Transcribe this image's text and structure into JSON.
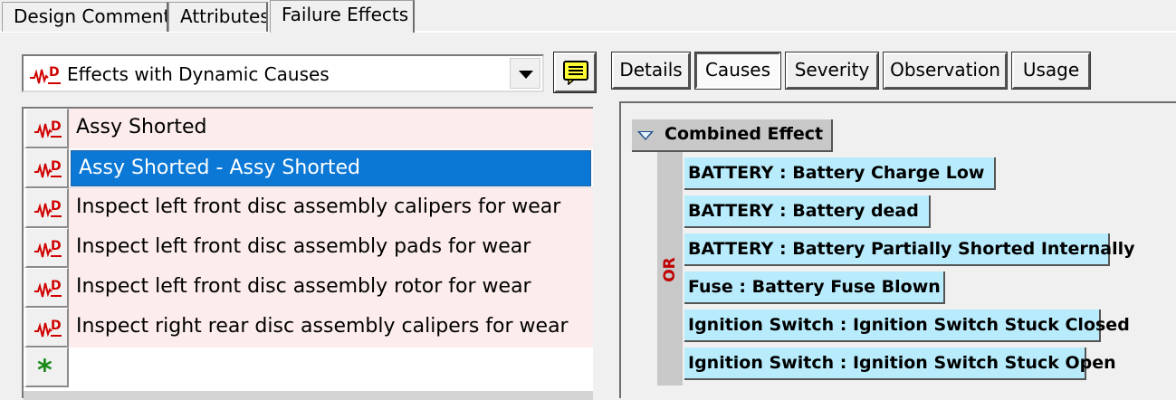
{
  "top_tabs": [
    {
      "label": "Design Comment",
      "active": false
    },
    {
      "label": "Attributes",
      "active": false
    },
    {
      "label": "Failure Effects",
      "active": true
    }
  ],
  "effect_filter": {
    "selected": "Effects with Dynamic Causes",
    "icon": "dynamic-cause-icon"
  },
  "note_button": {
    "icon": "note-icon"
  },
  "effects": [
    {
      "label": "Assy Shorted",
      "icon": "dynamic-cause-icon",
      "selected": false
    },
    {
      "label": "Assy Shorted - Assy Shorted",
      "icon": "dynamic-cause-icon",
      "selected": true
    },
    {
      "label": "Inspect left front disc assembly calipers for wear",
      "icon": "dynamic-cause-icon",
      "selected": false
    },
    {
      "label": "Inspect left front disc assembly pads for wear",
      "icon": "dynamic-cause-icon",
      "selected": false
    },
    {
      "label": "Inspect left front disc assembly rotor for wear",
      "icon": "dynamic-cause-icon",
      "selected": false
    },
    {
      "label": "Inspect right rear disc assembly calipers for wear",
      "icon": "dynamic-cause-icon",
      "selected": false
    },
    {
      "label": "",
      "icon": "add-new-icon",
      "selected": false
    }
  ],
  "detail_tabs": [
    {
      "label": "Details",
      "active": false
    },
    {
      "label": "Causes",
      "active": true
    },
    {
      "label": "Severity",
      "active": false
    },
    {
      "label": "Observation",
      "active": false
    },
    {
      "label": "Usage",
      "active": false
    }
  ],
  "cause_tree": {
    "root_label": "Combined Effect",
    "gate": "OR",
    "causes": [
      "BATTERY : Battery Charge Low",
      "BATTERY : Battery dead",
      "BATTERY : Battery Partially Shorted Internally",
      "Fuse : Battery Fuse Blown",
      "Ignition Switch : Ignition Switch Stuck Closed",
      "Ignition Switch : Ignition Switch Stuck Open"
    ]
  },
  "colors": {
    "selection": "#0c78d6",
    "row_background": "#fcecec",
    "cause_background": "#b8ecfc",
    "gate_text": "#c00000",
    "icon_red": "#d00000",
    "add_green": "#1a8a1a"
  }
}
